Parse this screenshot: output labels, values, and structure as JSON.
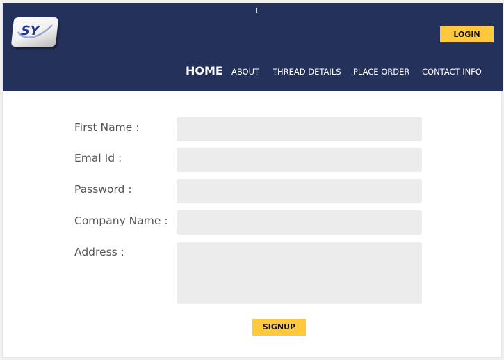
{
  "brand": {
    "logo_text": "SY",
    "accent_color": "#ffc83d",
    "header_color": "#24315a"
  },
  "header": {
    "login_label": "LOGIN"
  },
  "nav": {
    "items": [
      {
        "label": "HOME"
      },
      {
        "label": "ABOUT"
      },
      {
        "label": "THREAD DETAILS"
      },
      {
        "label": "PLACE ORDER"
      },
      {
        "label": "CONTACT INFO"
      }
    ]
  },
  "form": {
    "fields": [
      {
        "label": "First Name :",
        "value": "",
        "placeholder": ""
      },
      {
        "label": "Emal Id :",
        "value": "",
        "placeholder": ""
      },
      {
        "label": "Password :",
        "value": "",
        "placeholder": ""
      },
      {
        "label": "Company Name :",
        "value": "",
        "placeholder": ""
      },
      {
        "label": "Address :",
        "value": "",
        "placeholder": ""
      }
    ],
    "submit_label": "SIGNUP"
  }
}
